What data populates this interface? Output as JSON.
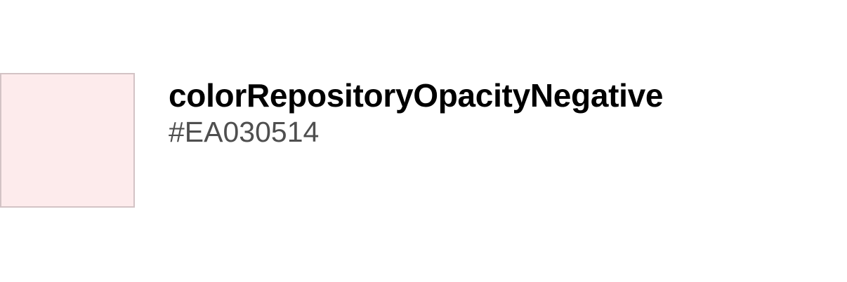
{
  "color_token": {
    "name": "colorRepositoryOpacityNegative",
    "value": "#EA030514",
    "swatch_fill": "#FDEBEC",
    "swatch_border": "#D3C3C5"
  }
}
